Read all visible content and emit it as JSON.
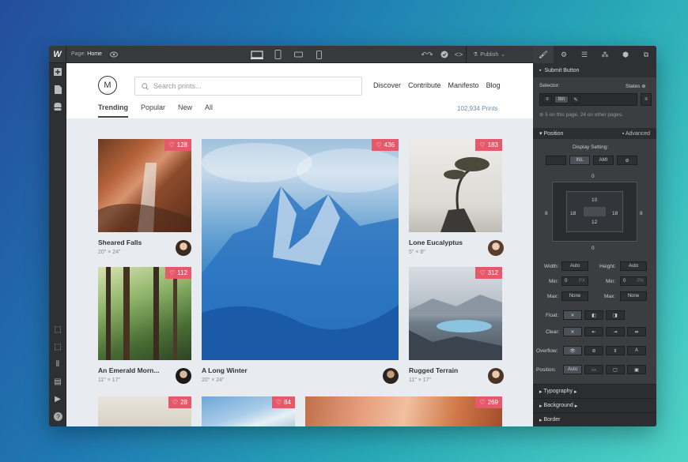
{
  "toolbar": {
    "logo": "W",
    "page_label": "Page:",
    "page_name": "Home",
    "publish_label": "Publish"
  },
  "site": {
    "logo_letter": "M",
    "search_placeholder": "Search prints...",
    "nav": [
      "Discover",
      "Contribute",
      "Manifesto",
      "Blog"
    ],
    "tabs": [
      "Trending",
      "Popular",
      "New",
      "All"
    ],
    "active_tab": "Trending",
    "print_count": "102,934 Prints"
  },
  "cards": [
    {
      "title": "Sheared Falls",
      "size": "20\" × 24\"",
      "likes": "128"
    },
    {
      "title": "A Long Winter",
      "size": "20\" × 24\"",
      "likes": "436"
    },
    {
      "title": "Lone Eucalyptus",
      "size": "5\" × 8\"",
      "likes": "183"
    },
    {
      "title": "An Emerald Morn...",
      "size": "11\" × 17\"",
      "likes": "112"
    },
    {
      "title": "Rugged Terrain",
      "size": "11\" × 17\"",
      "likes": "312"
    },
    {
      "likes": "28"
    },
    {
      "likes": "84"
    },
    {
      "likes": "269"
    }
  ],
  "panel": {
    "element_title": "Submit Button",
    "selector_label": "Selector:",
    "states_label": "States",
    "selector_tag": "btn",
    "selector_info": "5 on this page, 24 on other pages.",
    "position_title": "Position",
    "advanced_label": "Advanced",
    "display_setting_label": "Display Setting:",
    "display_opts": [
      "",
      "INL",
      "AMI",
      ""
    ],
    "box": {
      "margin_top": "0",
      "margin_bottom": "0",
      "margin_left": "8",
      "margin_right": "8",
      "pad_top": "10",
      "pad_left": "18",
      "pad_right": "18",
      "pad_bottom": "12"
    },
    "width_label": "Width:",
    "width_val": "Auto",
    "height_label": "Height:",
    "height_val": "Auto",
    "min_label": "Min:",
    "min_w": "0",
    "min_h": "0",
    "px_unit": "PX",
    "max_label": "Max:",
    "max_w": "None",
    "max_h": "None",
    "float_label": "Float:",
    "clear_label": "Clear:",
    "overflow_label": "Overflow:",
    "position_label": "Position:",
    "position_val": "Auto",
    "sections": [
      "Typography",
      "Background",
      "Border"
    ]
  }
}
